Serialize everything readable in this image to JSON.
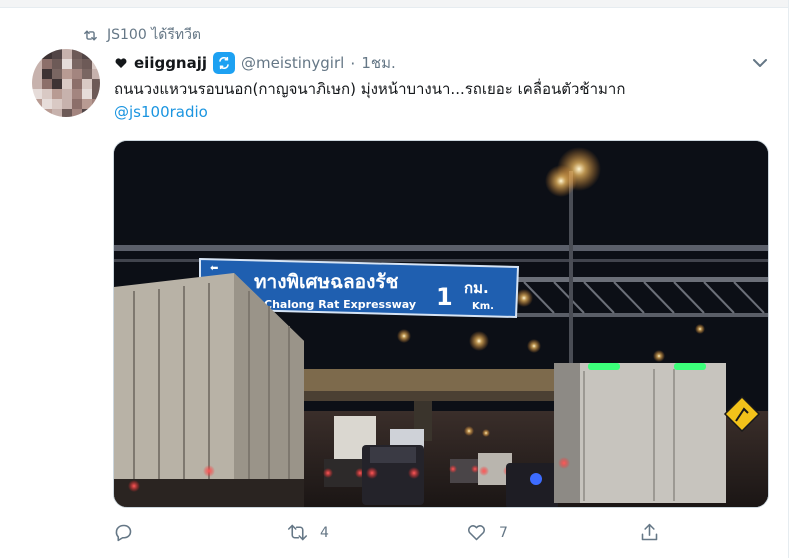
{
  "retweet": {
    "label": "JS100 ได้รีทวีต"
  },
  "tweet": {
    "display_name": "eiiggnajj",
    "handle": "@meistinygirl",
    "separator": "·",
    "time": "1ชม.",
    "text": "ถนนวงแหวนรอบนอก(กาญจนาภิเษก) มุ่งหน้าบางนา...รถเยอะ เคลื่อนตัวช้ามาก",
    "mention": "@js100radio"
  },
  "photo": {
    "sign_thai": "ทางพิเศษฉลองรัช",
    "sign_english": "Chalong Rat Expressway",
    "sign_distance": "1",
    "sign_unit_thai": "กม.",
    "sign_unit_english": "Km.",
    "sign_color": "#1f5fb0"
  },
  "actions": {
    "reply_count": "",
    "retweet_count": "4",
    "like_count": "7"
  },
  "colors": {
    "accent": "#1da1f2",
    "link": "#1b95e0",
    "muted": "#657786"
  }
}
